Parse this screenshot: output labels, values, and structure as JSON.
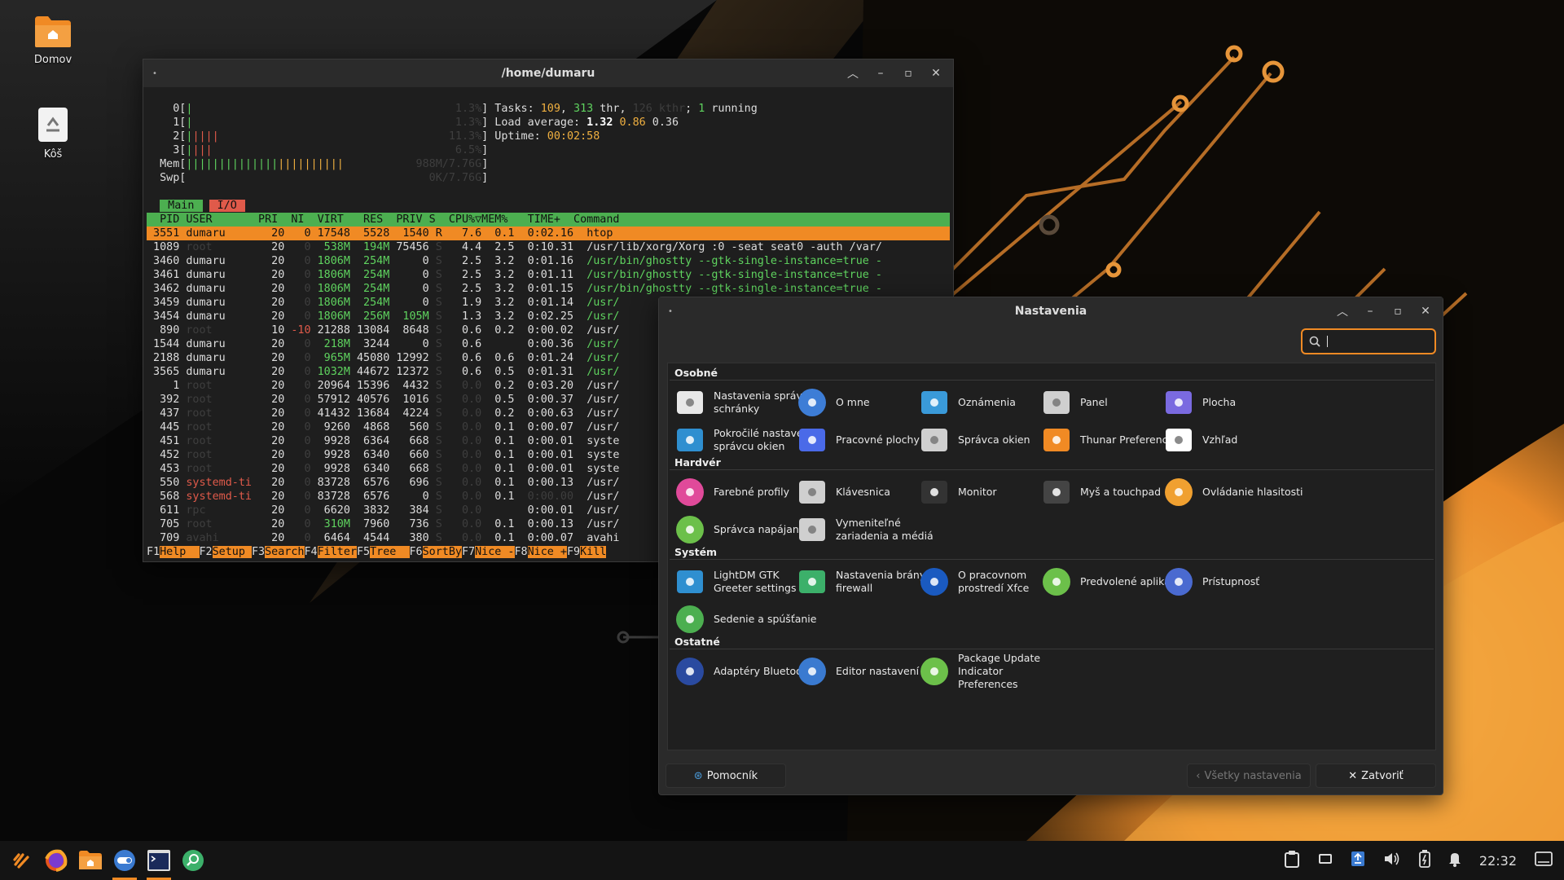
{
  "desktop": {
    "icons": [
      {
        "label": "Domov"
      },
      {
        "label": "Kôš"
      }
    ]
  },
  "terminal": {
    "title": "/home/dumaru",
    "htop": {
      "tasks_label": "Tasks: ",
      "tasks": "109",
      "thr_count": "313",
      "thr": " thr, ",
      "kthr": "126 kthr",
      "running_count": "1",
      "running": " running",
      "load_label": "Load average: ",
      "load1": "1.32",
      "load5": "0.86",
      "load15": "0.36",
      "uptime_label": "Uptime: ",
      "uptime": "00:02:58",
      "cpu_rows": [
        {
          "id": "0",
          "bars": "|",
          "pct": "1.3%"
        },
        {
          "id": "1",
          "bars": "|",
          "pct": "1.3%"
        },
        {
          "id": "2",
          "bars": "|||||",
          "pct": "11.3%"
        },
        {
          "id": "3",
          "bars": "||||",
          "pct": "6.5%"
        }
      ],
      "mem_label": "Mem",
      "mem_bars": "||||||||||||||||||||||||",
      "mem_val": "988M/7.76G",
      "swp_label": "Swp",
      "swp_val": "0K/7.76G",
      "tabs": {
        "main": "Main",
        "io": "I/O"
      },
      "header": "  PID USER       PRI  NI  VIRT   RES  PRIV S  CPU%▽MEM%   TIME+  Command",
      "rows": [
        {
          "pid": "3551",
          "user": "dumaru",
          "pri": "20",
          "ni": "0",
          "virt": "17548",
          "res": "5528",
          "priv": "1540",
          "s": "R",
          "cpu": "7.6",
          "mem": "0.1",
          "time": "0:02.16",
          "cmd": "htop",
          "sel": true
        },
        {
          "pid": "1089",
          "user": "root",
          "pri": "20",
          "ni": "0",
          "virt": "538M",
          "res": "194M",
          "priv": "75456",
          "s": "S",
          "cpu": "4.4",
          "mem": "2.5",
          "time": "0:10.31",
          "cmd": "/usr/lib/xorg/Xorg :0 -seat seat0 -auth /var/"
        },
        {
          "pid": "3460",
          "user": "dumaru",
          "pri": "20",
          "ni": "0",
          "virt": "1806M",
          "res": "254M",
          "priv": "0",
          "s": "S",
          "cpu": "2.5",
          "mem": "3.2",
          "time": "0:01.16",
          "cmd": "/usr/bin/ghostty --gtk-single-instance=true -"
        },
        {
          "pid": "3461",
          "user": "dumaru",
          "pri": "20",
          "ni": "0",
          "virt": "1806M",
          "res": "254M",
          "priv": "0",
          "s": "S",
          "cpu": "2.5",
          "mem": "3.2",
          "time": "0:01.11",
          "cmd": "/usr/bin/ghostty --gtk-single-instance=true -"
        },
        {
          "pid": "3462",
          "user": "dumaru",
          "pri": "20",
          "ni": "0",
          "virt": "1806M",
          "res": "254M",
          "priv": "0",
          "s": "S",
          "cpu": "2.5",
          "mem": "3.2",
          "time": "0:01.15",
          "cmd": "/usr/bin/ghostty --gtk-single-instance=true -"
        },
        {
          "pid": "3459",
          "user": "dumaru",
          "pri": "20",
          "ni": "0",
          "virt": "1806M",
          "res": "254M",
          "priv": "0",
          "s": "S",
          "cpu": "1.9",
          "mem": "3.2",
          "time": "0:01.14",
          "cmd": "/usr/"
        },
        {
          "pid": "3454",
          "user": "dumaru",
          "pri": "20",
          "ni": "0",
          "virt": "1806M",
          "res": "256M",
          "priv": "105M",
          "s": "S",
          "cpu": "1.3",
          "mem": "3.2",
          "time": "0:02.25",
          "cmd": "/usr/"
        },
        {
          "pid": "890",
          "user": "root",
          "pri": "10",
          "ni": "-10",
          "virt": "21288",
          "res": "13084",
          "priv": "8648",
          "s": "S",
          "cpu": "0.6",
          "mem": "0.2",
          "time": "0:00.02",
          "cmd": "/usr/"
        },
        {
          "pid": "1544",
          "user": "dumaru",
          "pri": "20",
          "ni": "0",
          "virt": "218M",
          "res": "3244",
          "priv": "0",
          "s": "S",
          "cpu": "0.6",
          "mem": "",
          "time": "0:00.36",
          "cmd": "/usr/"
        },
        {
          "pid": "2188",
          "user": "dumaru",
          "pri": "20",
          "ni": "0",
          "virt": "965M",
          "res": "45080",
          "priv": "12992",
          "s": "S",
          "cpu": "0.6",
          "mem": "0.6",
          "time": "0:01.24",
          "cmd": "/usr/"
        },
        {
          "pid": "3565",
          "user": "dumaru",
          "pri": "20",
          "ni": "0",
          "virt": "1032M",
          "res": "44672",
          "priv": "12372",
          "s": "S",
          "cpu": "0.6",
          "mem": "0.5",
          "time": "0:01.31",
          "cmd": "/usr/"
        },
        {
          "pid": "1",
          "user": "root",
          "pri": "20",
          "ni": "0",
          "virt": "20964",
          "res": "15396",
          "priv": "4432",
          "s": "S",
          "cpu": "0.0",
          "mem": "0.2",
          "time": "0:03.20",
          "cmd": "/usr/"
        },
        {
          "pid": "392",
          "user": "root",
          "pri": "20",
          "ni": "0",
          "virt": "57912",
          "res": "40576",
          "priv": "1016",
          "s": "S",
          "cpu": "0.0",
          "mem": "0.5",
          "time": "0:00.37",
          "cmd": "/usr/"
        },
        {
          "pid": "437",
          "user": "root",
          "pri": "20",
          "ni": "0",
          "virt": "41432",
          "res": "13684",
          "priv": "4224",
          "s": "S",
          "cpu": "0.0",
          "mem": "0.2",
          "time": "0:00.63",
          "cmd": "/usr/"
        },
        {
          "pid": "445",
          "user": "root",
          "pri": "20",
          "ni": "0",
          "virt": "9260",
          "res": "4868",
          "priv": "560",
          "s": "S",
          "cpu": "0.0",
          "mem": "0.1",
          "time": "0:00.07",
          "cmd": "/usr/"
        },
        {
          "pid": "451",
          "user": "root",
          "pri": "20",
          "ni": "0",
          "virt": "9928",
          "res": "6364",
          "priv": "668",
          "s": "S",
          "cpu": "0.0",
          "mem": "0.1",
          "time": "0:00.01",
          "cmd": "syste"
        },
        {
          "pid": "452",
          "user": "root",
          "pri": "20",
          "ni": "0",
          "virt": "9928",
          "res": "6340",
          "priv": "660",
          "s": "S",
          "cpu": "0.0",
          "mem": "0.1",
          "time": "0:00.01",
          "cmd": "syste"
        },
        {
          "pid": "453",
          "user": "root",
          "pri": "20",
          "ni": "0",
          "virt": "9928",
          "res": "6340",
          "priv": "668",
          "s": "S",
          "cpu": "0.0",
          "mem": "0.1",
          "time": "0:00.01",
          "cmd": "syste"
        },
        {
          "pid": "550",
          "user": "systemd-ti",
          "pri": "20",
          "ni": "0",
          "virt": "83728",
          "res": "6576",
          "priv": "696",
          "s": "S",
          "cpu": "0.0",
          "mem": "0.1",
          "time": "0:00.13",
          "cmd": "/usr/"
        },
        {
          "pid": "568",
          "user": "systemd-ti",
          "pri": "20",
          "ni": "0",
          "virt": "83728",
          "res": "6576",
          "priv": "0",
          "s": "S",
          "cpu": "0.0",
          "mem": "0.1",
          "time": "0:00.00",
          "cmd": "/usr/"
        },
        {
          "pid": "611",
          "user": "rpc",
          "pri": "20",
          "ni": "0",
          "virt": "6620",
          "res": "3832",
          "priv": "384",
          "s": "S",
          "cpu": "0.0",
          "mem": "",
          "time": "0:00.01",
          "cmd": "/usr/"
        },
        {
          "pid": "705",
          "user": "root",
          "pri": "20",
          "ni": "0",
          "virt": "310M",
          "res": "7960",
          "priv": "736",
          "s": "S",
          "cpu": "0.0",
          "mem": "0.1",
          "time": "0:00.13",
          "cmd": "/usr/"
        },
        {
          "pid": "709",
          "user": "avahi",
          "pri": "20",
          "ni": "0",
          "virt": "6464",
          "res": "4544",
          "priv": "380",
          "s": "S",
          "cpu": "0.0",
          "mem": "0.1",
          "time": "0:00.07",
          "cmd": "avahi"
        }
      ],
      "fkeys": [
        {
          "k": "F1",
          "l": "Help  "
        },
        {
          "k": "F2",
          "l": "Setup "
        },
        {
          "k": "F3",
          "l": "Search"
        },
        {
          "k": "F4",
          "l": "Filter"
        },
        {
          "k": "F5",
          "l": "Tree  "
        },
        {
          "k": "F6",
          "l": "SortBy"
        },
        {
          "k": "F7",
          "l": "Nice -"
        },
        {
          "k": "F8",
          "l": "Nice +"
        },
        {
          "k": "F9",
          "l": "Kill"
        }
      ]
    }
  },
  "settings": {
    "title": "Nastavenia",
    "search_value": "",
    "categories": [
      {
        "name": "Osobné",
        "items": [
          {
            "label": "Nastavenia správcu schránky",
            "icon": "clipboard-icon",
            "color": "#e8e8e8"
          },
          {
            "label": "O mne",
            "icon": "user-icon",
            "color": "#3d7dd6"
          },
          {
            "label": "Oznámenia",
            "icon": "notification-icon",
            "color": "#3a9ad9"
          },
          {
            "label": "Panel",
            "icon": "panel-icon",
            "color": "#cfcfcf"
          },
          {
            "label": "Plocha",
            "icon": "desktop-icon",
            "color": "#7a6ae0"
          },
          {
            "label": "Pokročilé nastavenie správcu okien",
            "icon": "wm-tweaks-icon",
            "color": "#2f8fd0"
          },
          {
            "label": "Pracovné plochy",
            "icon": "workspaces-icon",
            "color": "#4a6ae8"
          },
          {
            "label": "Správca okien",
            "icon": "window-manager-icon",
            "color": "#cfcfcf"
          },
          {
            "label": "Thunar Preferences",
            "icon": "folder-home-icon",
            "color": "#f08a24"
          },
          {
            "label": "Vzhľad",
            "icon": "appearance-icon",
            "color": "#ffffff"
          }
        ]
      },
      {
        "name": "Hardvér",
        "items": [
          {
            "label": "Farebné profily",
            "icon": "color-profile-icon",
            "color": "#e04a9a"
          },
          {
            "label": "Klávesnica",
            "icon": "keyboard-icon",
            "color": "#cfcfcf"
          },
          {
            "label": "Monitor",
            "icon": "monitor-icon",
            "color": "#333333"
          },
          {
            "label": "Myš a touchpad",
            "icon": "mouse-icon",
            "color": "#444444"
          },
          {
            "label": "Ovládanie hlasitosti",
            "icon": "volume-control-icon",
            "color": "#f0a030"
          },
          {
            "label": "Správca napájania",
            "icon": "power-manager-icon",
            "color": "#6cc04a"
          },
          {
            "label": "Vymeniteľné zariadenia a médiá",
            "icon": "removable-drive-icon",
            "color": "#cfcfcf"
          }
        ]
      },
      {
        "name": "Systém",
        "items": [
          {
            "label": "LightDM GTK Greeter settings",
            "icon": "greeter-icon",
            "color": "#2f8fd0"
          },
          {
            "label": "Nastavenia brány firewall",
            "icon": "firewall-icon",
            "color": "#3cb06a"
          },
          {
            "label": "O pracovnom prostredí Xfce",
            "icon": "xfce-icon",
            "color": "#1a5ac0"
          },
          {
            "label": "Predvolené aplikácie",
            "icon": "default-apps-icon",
            "color": "#6cc04a"
          },
          {
            "label": "Prístupnosť",
            "icon": "accessibility-icon",
            "color": "#4a6ad0"
          },
          {
            "label": "Sedenie a spúšťanie",
            "icon": "session-icon",
            "color": "#4caf50"
          }
        ]
      },
      {
        "name": "Ostatné",
        "items": [
          {
            "label": "Adaptéry Bluetooth",
            "icon": "bluetooth-icon",
            "color": "#2a4aa0"
          },
          {
            "label": "Editor nastavení",
            "icon": "settings-editor-icon",
            "color": "#3a7ad0"
          },
          {
            "label": "Package Update Indicator Preferences",
            "icon": "package-update-icon",
            "color": "#6cc04a"
          }
        ]
      }
    ],
    "footer": {
      "help": "Pomocník",
      "all": "Všetky nastavenia",
      "close": "Zatvoriť"
    }
  },
  "taskbar": {
    "clock": "22:32",
    "apps": [
      "menu-icon",
      "firefox-icon",
      "file-manager-icon",
      "settings-icon",
      "terminal-icon",
      "search-icon"
    ]
  },
  "colors": {
    "accent": "#f08a24",
    "htop_green": "#4caf50",
    "htop_red": "#e05a4a"
  }
}
